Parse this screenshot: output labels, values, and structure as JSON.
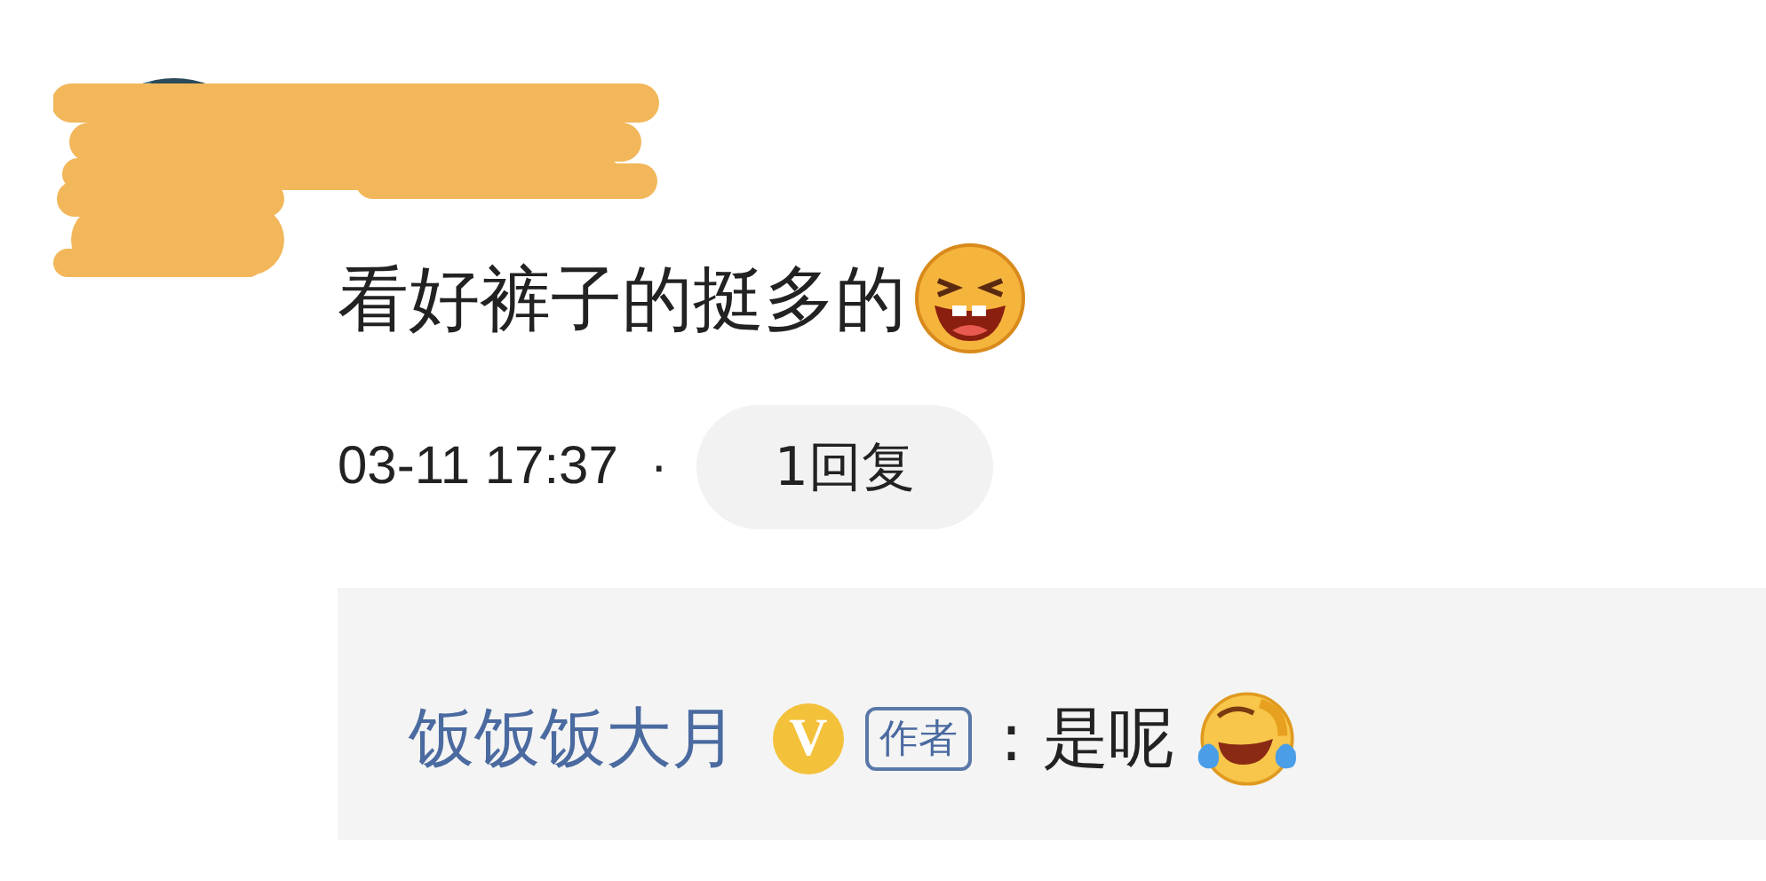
{
  "comment": {
    "text": "看好裤子的挺多的",
    "time": "03-11 17:37",
    "separator": "·",
    "reply_count": "1回复"
  },
  "reply": {
    "author": "饭饭饭大月",
    "verified_badge": "V",
    "author_tag": "作者",
    "colon": ":",
    "text": "是呢"
  }
}
